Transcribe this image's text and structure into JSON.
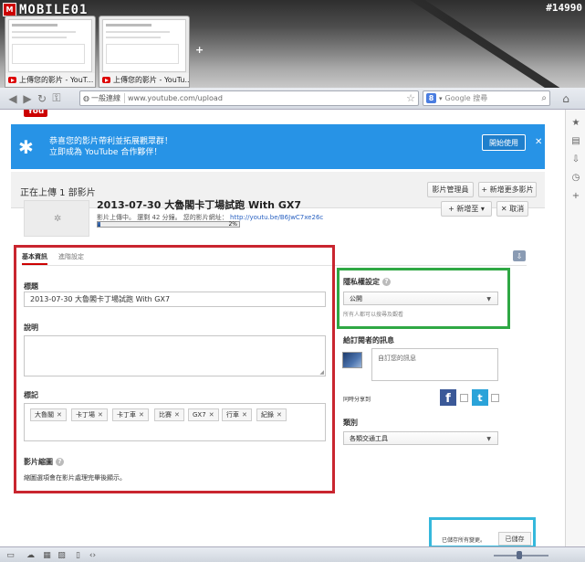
{
  "watermark": {
    "logo_text": "MOBILE01",
    "tag": "#14990"
  },
  "browser": {
    "tabs": [
      {
        "label": "上傳您的影片 - YouT..."
      },
      {
        "label": "上傳您的影片 - YouTu..."
      }
    ],
    "site_label": "一般連線",
    "url": "www.youtube.com/upload",
    "search_placeholder": "Google 搜尋"
  },
  "yt_logo": "You",
  "banner": {
    "line1": "恭喜您的影片帶利並拓展觀眾群！",
    "line2": "立即成為 YouTube 合作夥伴！",
    "start_button": "開始使用",
    "close": "✕"
  },
  "upload": {
    "header_title": "正在上傳 1 部影片",
    "video_manager_button": "影片管理員",
    "add_more_button": "+ 新增更多影片",
    "video": {
      "title": "2013-07-30 大魯閣卡丁場試跑 With GX7",
      "status_text": "影片上傳中。 還剩 42 分鐘。 您的影片網址：",
      "link": "http://youtu.be/B6JwC7xe26c",
      "progress": 2,
      "progress_label": "2%"
    },
    "add_to_button": "+ 新增至 ▾",
    "cancel_button": "✕  取消"
  },
  "form": {
    "tabs": [
      {
        "label": "基本資訊",
        "active": true
      },
      {
        "label": "進階設定",
        "active": false
      }
    ],
    "title_label": "標題",
    "title_value": "2013-07-30 大魯閣卡丁場試跑 With GX7",
    "description_label": "說明",
    "tags_label": "標記",
    "tags": [
      "大魯閣",
      "卡丁場",
      "卡丁車",
      "比賽",
      "GX7",
      "行車",
      "紀錄"
    ],
    "thumb_label": "影片縮圖",
    "thumb_text": "縮圖選項會在影片處理完畢後顯示。"
  },
  "privacy": {
    "label": "隱私權設定",
    "value": "公開",
    "hint": "所有人都可以搜尋及觀看"
  },
  "subscribers": {
    "label": "給訂閱者的訊息",
    "placeholder": "自訂您的訊息"
  },
  "share": {
    "label": "同時分享到",
    "facebook": "f",
    "twitter": "t"
  },
  "category": {
    "label": "類別",
    "value": "各類交通工具"
  },
  "save": {
    "status": "已儲存所有變更。",
    "button": "已儲存"
  },
  "colors": {
    "banner_blue": "#2793e6",
    "annotation_red": "#c9252f",
    "annotation_green": "#2fa844",
    "annotation_cyan": "#35b8dc"
  }
}
